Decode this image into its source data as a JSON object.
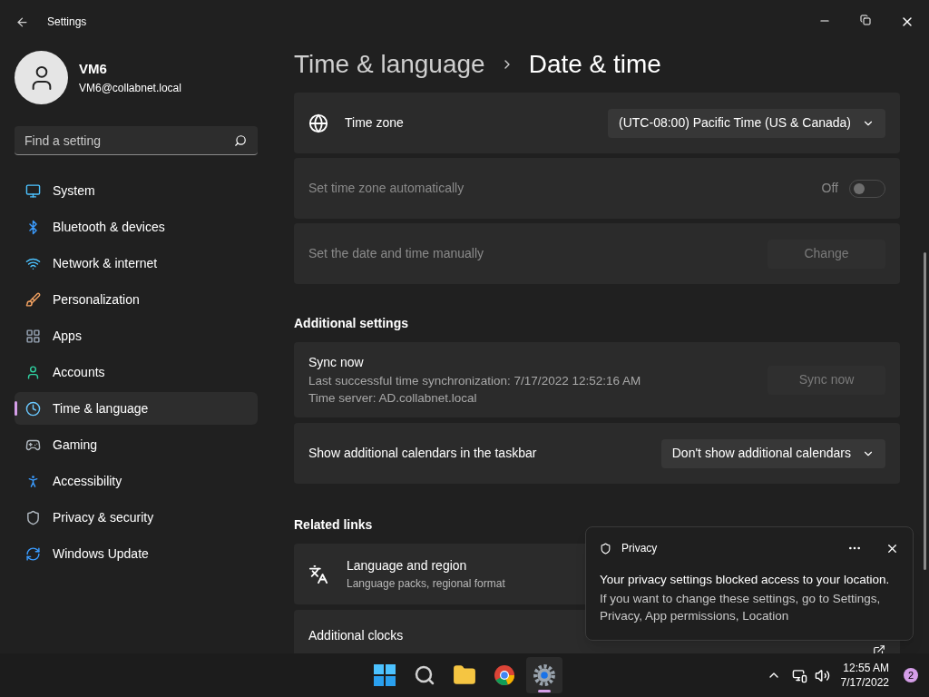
{
  "window": {
    "title": "Settings"
  },
  "user": {
    "name": "VM6",
    "email": "VM6@collabnet.local"
  },
  "search": {
    "placeholder": "Find a setting"
  },
  "sidebar": {
    "items": [
      {
        "kind": "system",
        "label": "System",
        "selected": false
      },
      {
        "kind": "bluetooth",
        "label": "Bluetooth & devices",
        "selected": false
      },
      {
        "kind": "network",
        "label": "Network & internet",
        "selected": false
      },
      {
        "kind": "personalization",
        "label": "Personalization",
        "selected": false
      },
      {
        "kind": "apps",
        "label": "Apps",
        "selected": false
      },
      {
        "kind": "accounts",
        "label": "Accounts",
        "selected": false
      },
      {
        "kind": "time",
        "label": "Time & language",
        "selected": true
      },
      {
        "kind": "gaming",
        "label": "Gaming",
        "selected": false
      },
      {
        "kind": "accessibility",
        "label": "Accessibility",
        "selected": false
      },
      {
        "kind": "privacy",
        "label": "Privacy & security",
        "selected": false
      },
      {
        "kind": "update",
        "label": "Windows Update",
        "selected": false
      }
    ]
  },
  "breadcrumb": {
    "parent": "Time & language",
    "current": "Date & time"
  },
  "settings": [
    {
      "kind": "dropdown",
      "label": "Time zone",
      "value": "(UTC-08:00) Pacific Time (US & Canada)",
      "disabled": false
    },
    {
      "kind": "toggle",
      "label": "Set time zone automatically",
      "state_text": "Off",
      "on": false,
      "disabled": true
    },
    {
      "kind": "button",
      "label": "Set the date and time manually",
      "button": "Change",
      "disabled": true
    }
  ],
  "additional": {
    "heading": "Additional settings",
    "items": [
      {
        "kind": "sync",
        "label": "Sync now",
        "lines": [
          "Last successful time synchronization: 7/17/2022 12:52:16 AM",
          "Time server: AD.collabnet.local"
        ],
        "button": "Sync now",
        "disabled": true
      },
      {
        "kind": "dropdown",
        "label": "Show additional calendars in the taskbar",
        "value": "Don't show additional calendars",
        "disabled": false
      }
    ]
  },
  "related": {
    "heading": "Related links",
    "items": [
      {
        "kind": "nav",
        "title": "Language and region",
        "subtitle": "Language packs, regional format"
      },
      {
        "kind": "external",
        "title": "Additional clocks"
      }
    ]
  },
  "toast": {
    "app": "Privacy",
    "title": "Your privacy settings blocked access to your location.",
    "body": "If you want to change these settings, go to Settings, Privacy, App permissions, Location"
  },
  "taskbar": {
    "apps": [
      {
        "kind": "start",
        "selected": false
      },
      {
        "kind": "search",
        "selected": false
      },
      {
        "kind": "explorer",
        "selected": false
      },
      {
        "kind": "browser",
        "selected": false
      },
      {
        "kind": "settings",
        "selected": true
      }
    ],
    "time": "12:55 AM",
    "date": "7/17/2022",
    "badge": "2"
  }
}
